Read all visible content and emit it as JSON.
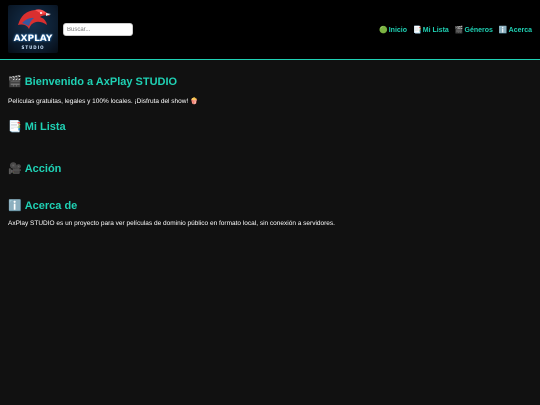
{
  "header": {
    "logo": {
      "title": "AXPLAY",
      "subtitle": "STUDIO",
      "icon": "eagle-icon",
      "accent_color": "#d92f2f"
    },
    "search": {
      "placeholder": "Buscar...",
      "value": ""
    },
    "nav": [
      {
        "icon": "🟢",
        "label": "Inicio"
      },
      {
        "icon": "📑",
        "label": "Mi Lista"
      },
      {
        "icon": "🎬",
        "label": "Géneros"
      },
      {
        "icon": "ℹ️",
        "label": "Acerca"
      }
    ]
  },
  "sections": {
    "welcome": {
      "icon": "🎬",
      "title": "Bienvenido a AxPlay STUDIO",
      "text": "Películas gratuitas, legales y 100% locales. ¡Disfruta del show! 🍿"
    },
    "mylist": {
      "icon": "📑",
      "title": "Mi Lista"
    },
    "action": {
      "icon": "🎥",
      "title": "Acción"
    },
    "about": {
      "icon": "ℹ️",
      "title": "Acerca de",
      "text": "AxPlay STUDIO es un proyecto para ver películas de dominio público en formato local, sin conexión a servidores."
    }
  },
  "colors": {
    "accent": "#1fd1b4",
    "background": "#111111",
    "header_background": "#000000",
    "text": "#ffffff"
  }
}
